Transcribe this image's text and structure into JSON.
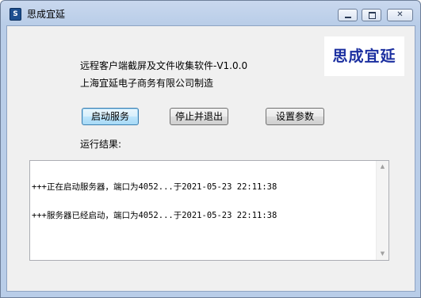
{
  "window": {
    "title": "思成宜延",
    "icon": "app-icon",
    "controls": {
      "minimize": "minimize-icon",
      "maximize": "maximize-icon",
      "close": "close-icon",
      "close_glyph": "✕"
    }
  },
  "logo": {
    "text": "思成宜延",
    "color": "#1b2fa0"
  },
  "info": {
    "product": "远程客户端截屏及文件收集软件-V1.0.0",
    "company": "上海宜延电子商务有限公司制造"
  },
  "buttons": {
    "start": "启动服务",
    "stop": "停止并退出",
    "settings": "设置参数"
  },
  "result": {
    "label": "运行结果:",
    "lines": [
      "+++正在启动服务器，端口为4052...于2021-05-23 22:11:38",
      "+++服务器已经启动，端口为4052...于2021-05-23 22:11:38"
    ]
  },
  "scrollbar": {
    "up": "▲",
    "down": "▼"
  }
}
